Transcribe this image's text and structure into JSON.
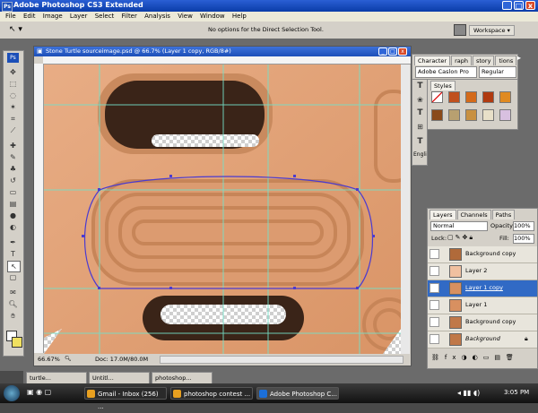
{
  "window": {
    "title": "Adobe Photoshop CS3 Extended",
    "min": "_",
    "max": "□",
    "close": "x"
  },
  "menu": [
    "File",
    "Edit",
    "Image",
    "Layer",
    "Select",
    "Filter",
    "Analysis",
    "View",
    "Window",
    "Help"
  ],
  "options_bar": {
    "message": "No options for the Direct Selection Tool.",
    "workspace_label": "Workspace ▾"
  },
  "document": {
    "title": "Stone Turtle sourceimage.psd @ 66.7% (Layer 1 copy, RGB/8#)",
    "zoom": "66.67%",
    "doc_info": "Doc: 17.0M/80.0M"
  },
  "character_panel": {
    "tabs": [
      "Character",
      "raph",
      "story",
      "tions"
    ],
    "font_family": "Adobe Caslon Pro",
    "font_style": "Regular",
    "sample": "Engli"
  },
  "styles_panel": {
    "tab": "Styles",
    "swatch_colors": [
      "#ffffff",
      "#c0501e",
      "#d46a1a",
      "#b03a10",
      "#e08a20",
      "#8a4a1a",
      "#b8a070",
      "#c89040",
      "#e8e0c8",
      "#d8c0e0"
    ]
  },
  "layers_panel": {
    "tabs": [
      "Layers",
      "Channels",
      "Paths"
    ],
    "blend_mode": "Normal",
    "opacity_label": "Opacity:",
    "opacity": "100%",
    "lock_label": "Lock:",
    "fill_label": "Fill:",
    "fill": "100%",
    "layers": [
      {
        "name": "Background copy",
        "selected": false,
        "visible": false,
        "thumb": "#b06a3a"
      },
      {
        "name": "Layer 2",
        "selected": false,
        "visible": false,
        "thumb": "#f0c0a0"
      },
      {
        "name": "Layer 1 copy",
        "selected": true,
        "visible": true,
        "thumb": "#d89060"
      },
      {
        "name": "Layer 1",
        "selected": false,
        "visible": false,
        "thumb": "#d89060"
      },
      {
        "name": "Background copy",
        "selected": false,
        "visible": false,
        "thumb": "#c07848"
      },
      {
        "name": "Background",
        "selected": false,
        "visible": false,
        "thumb": "#c07848"
      }
    ]
  },
  "minimized_docs": [
    {
      "label": "turtle..."
    },
    {
      "label": "Untitl..."
    },
    {
      "label": "photoshop..."
    }
  ],
  "taskbar": {
    "items": [
      {
        "label": "Gmail - Inbox (256) ...",
        "color": "#e8a020"
      },
      {
        "label": "photoshop contest ...",
        "color": "#e8a020"
      },
      {
        "label": "Adobe Photoshop C...",
        "color": "#1c6fd8"
      }
    ],
    "clock": "3:05 PM"
  },
  "colors": {
    "accent": "#316ac5",
    "clay": "#e3a47b",
    "path": "#4b3bd0",
    "guide": "#74e0c8"
  }
}
